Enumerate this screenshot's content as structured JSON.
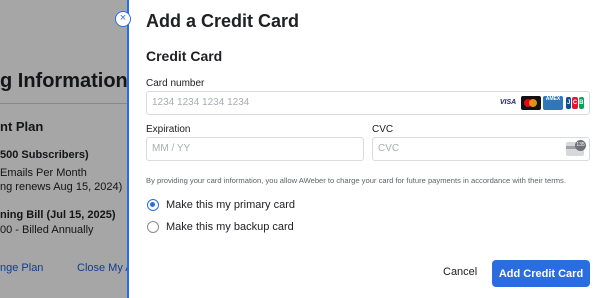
{
  "background": {
    "title": "g Information",
    "plan_heading": "nt Plan",
    "subscribers": "500 Subscribers)",
    "emails": "Emails Per Month",
    "renews": "ng renews Aug 15, 2024)",
    "bill": "ning Bill (Jul 15, 2025)",
    "billed": "00 - Billed Annually",
    "change_plan": "nge Plan",
    "close_account": "Close My A"
  },
  "modal": {
    "close_symbol": "×",
    "title": "Add a Credit Card",
    "section_title": "Credit Card",
    "card_number": {
      "label": "Card number",
      "placeholder": "1234 1234 1234 1234"
    },
    "card_brands": {
      "visa": "VISA",
      "amex": "AMEX",
      "jcb": [
        "J",
        "C",
        "B"
      ]
    },
    "expiration": {
      "label": "Expiration",
      "placeholder": "MM / YY"
    },
    "cvc": {
      "label": "CVC",
      "placeholder": "CVC",
      "icon_number": "135"
    },
    "disclaimer": "By providing your card information, you allow AWeber to charge your card for future payments in accordance with their terms.",
    "radio_options": [
      {
        "label": "Make this my primary card",
        "checked": true
      },
      {
        "label": "Make this my backup card",
        "checked": false
      }
    ],
    "cancel_label": "Cancel",
    "submit_label": "Add Credit Card"
  },
  "colors": {
    "accent": "#2a6de0",
    "link": "#1d5fd6"
  }
}
